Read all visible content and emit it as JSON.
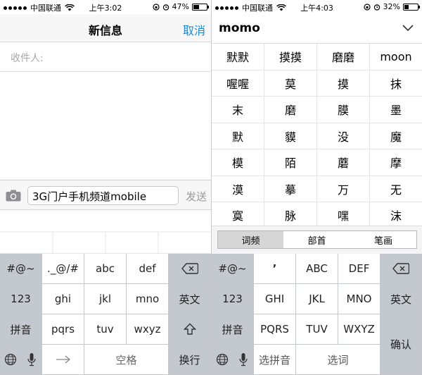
{
  "left": {
    "status": {
      "carrier": "中国联通",
      "time": "上午3:02",
      "battery": "47%",
      "battery_level": 0.47
    },
    "nav": {
      "title": "新信息",
      "cancel": "取消"
    },
    "recipient_label": "收件人:",
    "message_value": "3G门户手机频道mobile",
    "send": "发送",
    "keys": {
      "symbols": "#@~",
      "k1": "._@/#",
      "abc": "abc",
      "def": "def",
      "num": "123",
      "ghi": "ghi",
      "jkl": "jkl",
      "mno": "mno",
      "english": "英文",
      "pinyin": "拼音",
      "pqrs": "pqrs",
      "tuv": "tuv",
      "wxyz": "wxyz",
      "space": "空格",
      "enter": "换行"
    }
  },
  "right": {
    "status": {
      "carrier": "中国联通",
      "time": "上午4:03",
      "battery": "32%",
      "battery_level": 0.32
    },
    "pinyin": "momo",
    "candidates": [
      [
        "默默",
        "摸摸",
        "磨磨",
        "moon"
      ],
      [
        "喔喔",
        "莫",
        "摸",
        "抹"
      ],
      [
        "末",
        "磨",
        "膜",
        "墨"
      ],
      [
        "默",
        "貘",
        "没",
        "魔"
      ],
      [
        "模",
        "陌",
        "蘑",
        "摩"
      ],
      [
        "漠",
        "摹",
        "万",
        "无"
      ],
      [
        "寞",
        "脉",
        "嘿",
        "沫"
      ]
    ],
    "tabs": [
      "词频",
      "部首",
      "笔画"
    ],
    "keys": {
      "symbols": "#@~",
      "k1": "’",
      "abc": "ABC",
      "def": "DEF",
      "num": "123",
      "ghi": "GHI",
      "jkl": "JKL",
      "mno": "MNO",
      "english": "英文",
      "pinyin": "拼音",
      "pqrs": "PQRS",
      "tuv": "TUV",
      "wxyz": "WXYZ",
      "select_pinyin": "选拼音",
      "select_word": "选词",
      "confirm": "确认"
    }
  },
  "colors": {
    "accent": "#1e88d8",
    "gray_key": "#c4c8cf",
    "placeholder": "#a8a8a8"
  }
}
